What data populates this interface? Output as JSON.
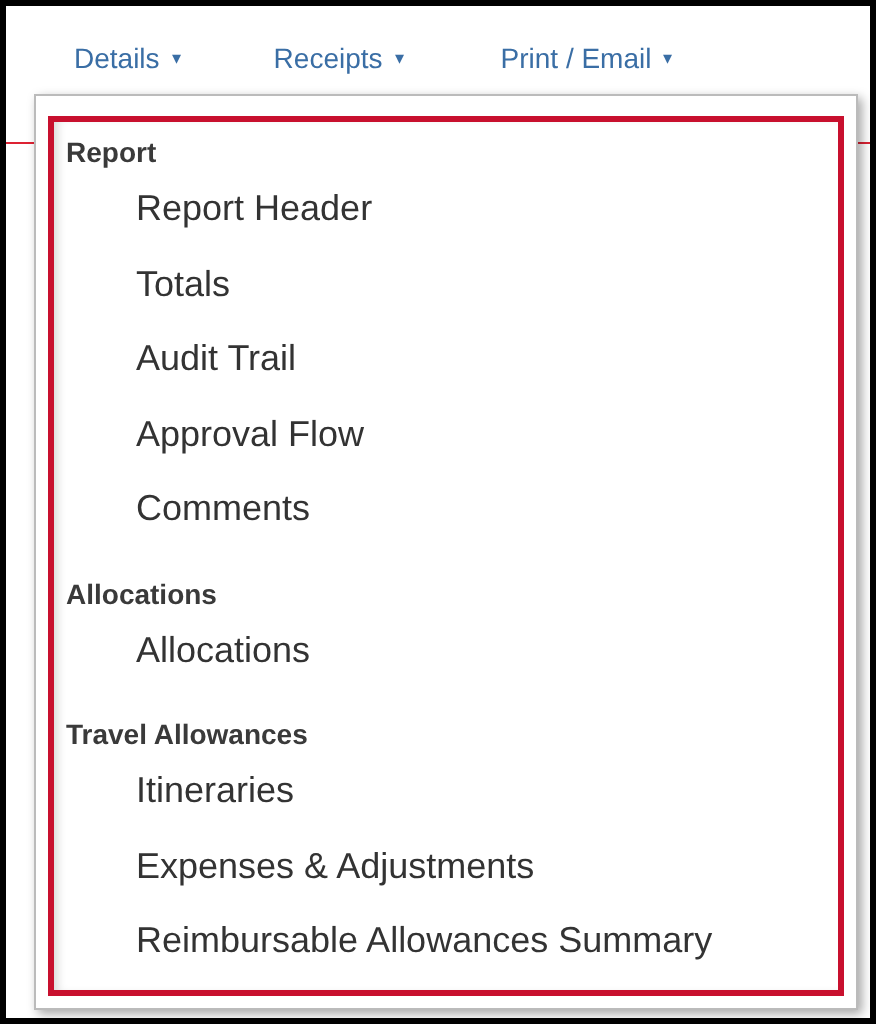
{
  "menu_bar": [
    {
      "label": "Details",
      "caret": "▾"
    },
    {
      "label": "Receipts",
      "caret": "▾"
    },
    {
      "label": "Print / Email",
      "caret": "▾"
    }
  ],
  "dropdown": {
    "sections": [
      {
        "heading": "Report",
        "items": [
          "Report Header",
          "Totals",
          "Audit Trail",
          "Approval Flow",
          "Comments"
        ]
      },
      {
        "heading": "Allocations",
        "items": [
          "Allocations"
        ]
      },
      {
        "heading": "Travel Allowances",
        "items": [
          "Itineraries",
          "Expenses & Adjustments",
          "Reimbursable Allowances Summary"
        ]
      }
    ],
    "highlighted": true
  }
}
